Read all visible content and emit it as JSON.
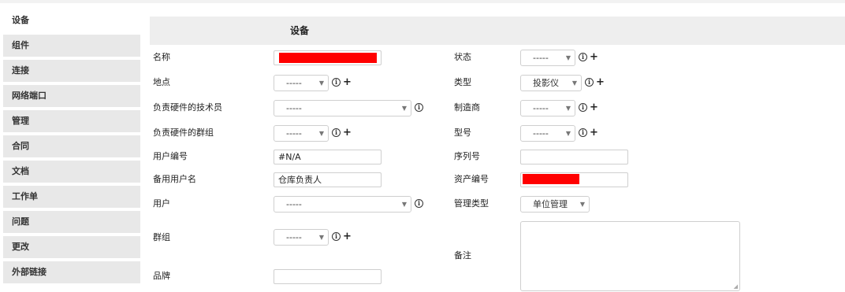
{
  "sidebar": {
    "items": [
      {
        "label": "设备"
      },
      {
        "label": "组件"
      },
      {
        "label": "连接"
      },
      {
        "label": "网络端口"
      },
      {
        "label": "管理"
      },
      {
        "label": "合同"
      },
      {
        "label": "文档"
      },
      {
        "label": "工作单"
      },
      {
        "label": "问题"
      },
      {
        "label": "更改"
      },
      {
        "label": "外部链接"
      }
    ]
  },
  "form": {
    "title": "设备",
    "empty_option": "-----",
    "left": {
      "name_label": "名称",
      "location_label": "地点",
      "tech_label": "负责硬件的技术员",
      "group_tech_label": "负责硬件的群组",
      "user_number_label": "用户编号",
      "user_number_value": "#N/A",
      "alt_username_label": "备用用户名",
      "alt_username_value": "仓库负责人",
      "user_label": "用户",
      "group_label": "群组",
      "brand_label": "品牌"
    },
    "right": {
      "status_label": "状态",
      "type_label": "类型",
      "type_value": "投影仪",
      "manufacturer_label": "制造商",
      "model_label": "型号",
      "serial_label": "序列号",
      "asset_label": "资产编号",
      "mgmt_type_label": "管理类型",
      "mgmt_type_value": "单位管理",
      "comments_label": "备注"
    }
  },
  "icons": {
    "info": "info-circle-icon",
    "add": "plus-icon",
    "dropdown": "chevron-down-icon"
  },
  "colors": {
    "redaction": "#ff0000",
    "sidebar_bg": "#e8e8e8",
    "header_bg": "#eeeeee"
  }
}
